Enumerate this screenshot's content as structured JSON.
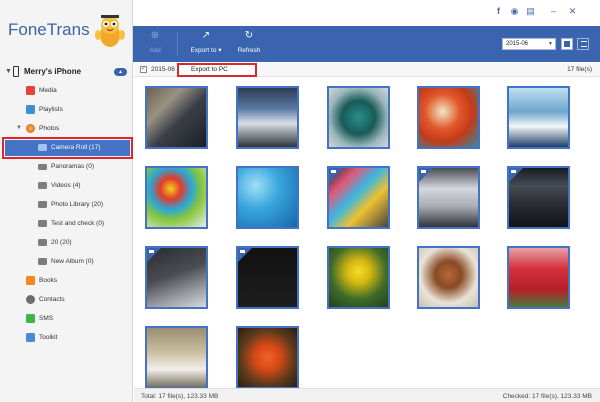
{
  "app": {
    "title": "FoneTrans"
  },
  "device": {
    "name": "Merry's iPhone"
  },
  "sidebar": {
    "items": [
      {
        "label": "Media",
        "icon": "music-icon",
        "color": "#e2443a"
      },
      {
        "label": "Playlists",
        "icon": "playlist-icon",
        "color": "#3d8fd8"
      },
      {
        "label": "Photos",
        "icon": "photos-icon",
        "color": "#f0a02a"
      },
      {
        "label": "Camera Roll (17)",
        "icon": "camera-icon",
        "color": "#9fc2ee"
      },
      {
        "label": "Panoramas (0)",
        "icon": "panorama-icon",
        "color": "#7d7d7d"
      },
      {
        "label": "Videos (4)",
        "icon": "video-icon",
        "color": "#7d7d7d"
      },
      {
        "label": "Photo Library (20)",
        "icon": "album-icon",
        "color": "#7d7d7d"
      },
      {
        "label": "Test and check (0)",
        "icon": "album-icon",
        "color": "#7d7d7d"
      },
      {
        "label": "20 (20)",
        "icon": "album-icon",
        "color": "#7d7d7d"
      },
      {
        "label": "New Album (0)",
        "icon": "album-icon",
        "color": "#7d7d7d"
      },
      {
        "label": "Books",
        "icon": "books-icon",
        "color": "#f08a1e"
      },
      {
        "label": "Contacts",
        "icon": "contacts-icon",
        "color": "#6d6d6d"
      },
      {
        "label": "SMS",
        "icon": "sms-icon",
        "color": "#3cb64a"
      },
      {
        "label": "Toolkit",
        "icon": "toolkit-icon",
        "color": "#4c8ad6"
      }
    ]
  },
  "toolbar": {
    "add_label": "Add",
    "export_label": "Export to",
    "refresh_label": "Refresh",
    "date_value": "2015-06"
  },
  "group": {
    "date": "2015-06",
    "count": "17 file(s)",
    "menu_item": "Export to PC"
  },
  "status": {
    "total": "Total: 17 file(s), 123.33 MB",
    "checked": "Checked: 17 file(s), 123.33 MB"
  },
  "colors": {
    "accent": "#3a64b0",
    "selection": "#4472c4",
    "highlight_red": "#e0242c"
  },
  "photos": [
    {
      "name": "laptop-photo",
      "video": false,
      "bg": "linear-gradient(135deg,#6b6152 0%,#9a9282 30%,#3b3f48 55%,#1d1f24 100%)"
    },
    {
      "name": "monitor-photo",
      "video": false,
      "bg": "linear-gradient(180deg,#2e3b52 0%,#5a7aa4 35%,#d9dde4 60%,#30333a 100%)"
    },
    {
      "name": "dodecahedron-photo",
      "video": false,
      "bg": "radial-gradient(circle at 50% 50%,#2a8f8a 0%,#185a58 40%,#9bb6ba 70%,#cfd9da 100%)"
    },
    {
      "name": "autumn-leaves-photo",
      "video": false,
      "bg": "radial-gradient(circle at 40% 40%,#f0e8c2 0%,#e2562b 35%,#c23b18 60%,#2f8ea8 100%)"
    },
    {
      "name": "snowy-mountain-photo",
      "video": false,
      "bg": "linear-gradient(180deg,#bfdff2 0%,#6ea6cc 40%,#f2f6f8 65%,#1d3e63 100%)"
    },
    {
      "name": "balloons-photo",
      "video": false,
      "bg": "radial-gradient(circle at 40% 35%,#f0d222 0%,#e23b2a 20%,#2aa7d8 40%,#88c63a 60%,#e6ecef 100%)"
    },
    {
      "name": "blue-wallpaper-photo",
      "video": false,
      "bg": "radial-gradient(circle at 30% 30%,#9fe0f8 0%,#3aa6dc 40%,#1565a8 100%)"
    },
    {
      "name": "ios-homescreen-photo",
      "video": true,
      "bg": "linear-gradient(135deg,#2a2a3a 0%,#e25a7a 25%,#3ab6e6 45%,#f0c030 65%,#444 100%)"
    },
    {
      "name": "screen-capture-photo",
      "video": true,
      "bg": "linear-gradient(180deg,#4a4d55 0%,#d4d7dc 35%,#a9adb4 65%,#30333a 100%)"
    },
    {
      "name": "dark-settings-photo",
      "video": true,
      "bg": "linear-gradient(180deg,#1a1c22 0%,#474b55 30%,#2b2e35 60%,#121317 100%)"
    },
    {
      "name": "keyboard-photo",
      "video": true,
      "bg": "linear-gradient(160deg,#2a2c30 0%,#4a4d52 45%,#9a9da2 75%,#d6d8dc 100%)"
    },
    {
      "name": "black-screen-photo",
      "video": true,
      "bg": "linear-gradient(180deg,#111 0%,#1d1d1d 100%)"
    },
    {
      "name": "yellow-flowers-photo",
      "video": false,
      "bg": "radial-gradient(circle at 50% 40%,#f6dc2a 0%,#d5b810 25%,#3f6b2a 60%,#23401b 100%)"
    },
    {
      "name": "dog-photo",
      "video": false,
      "bg": "radial-gradient(circle at 50% 45%,#b3683a 0%,#8a4a24 30%,#e9e3d8 65%,#c9c0b0 100%)"
    },
    {
      "name": "tulip-field-photo",
      "video": false,
      "bg": "linear-gradient(180deg,#e6a0a6 0%,#d5313c 35%,#b52028 70%,#4a7a38 100%)"
    },
    {
      "name": "birds-photo",
      "video": false,
      "bg": "linear-gradient(180deg,#9a8e74 0%,#c9bf9e 40%,#f0eee8 70%,#7a7260 100%)"
    },
    {
      "name": "salamander-photo",
      "video": false,
      "bg": "radial-gradient(circle at 50% 50%,#f0622a 0%,#d84816 30%,#5a3a1c 65%,#2e1e10 100%)"
    }
  ]
}
